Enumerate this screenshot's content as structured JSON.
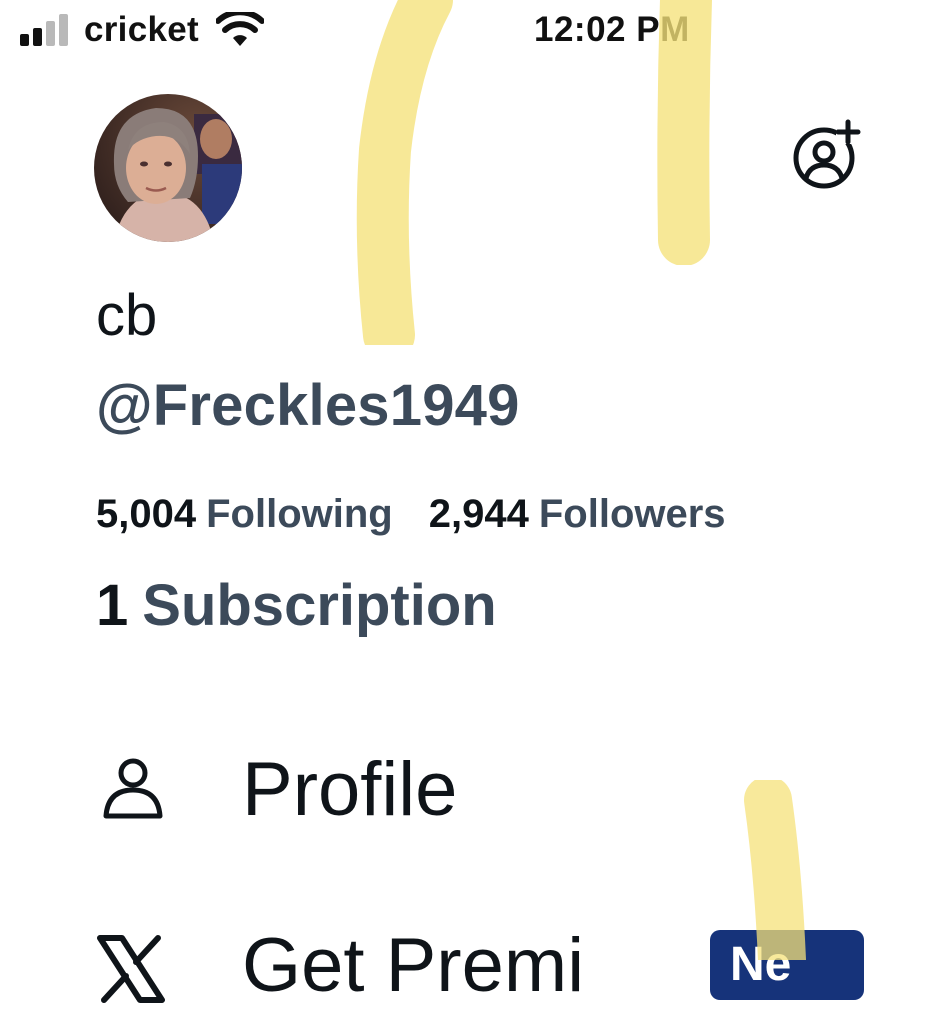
{
  "status_bar": {
    "carrier": "cricket",
    "time": "12:02 PM",
    "signal_bars_filled": 2,
    "signal_bars_total": 4
  },
  "profile": {
    "display_name": "cb",
    "handle": "@Freckles1949",
    "following_count": "5,004",
    "following_label": "Following",
    "followers_count": "2,944",
    "followers_label": "Followers",
    "subscription_count": "1",
    "subscription_label": "Subscription"
  },
  "menu": {
    "items": [
      {
        "label": "Profile",
        "icon": "person-icon"
      },
      {
        "label": "Get Premi",
        "icon": "x-logo-icon"
      }
    ],
    "premium_badge": "Ne"
  },
  "icons": {
    "add_account": "add-account-icon"
  },
  "colors": {
    "primary_text": "#0f1419",
    "secondary_text": "#3c4a5a",
    "badge_bg": "#16337a",
    "highlighter": "#f5e27a"
  }
}
